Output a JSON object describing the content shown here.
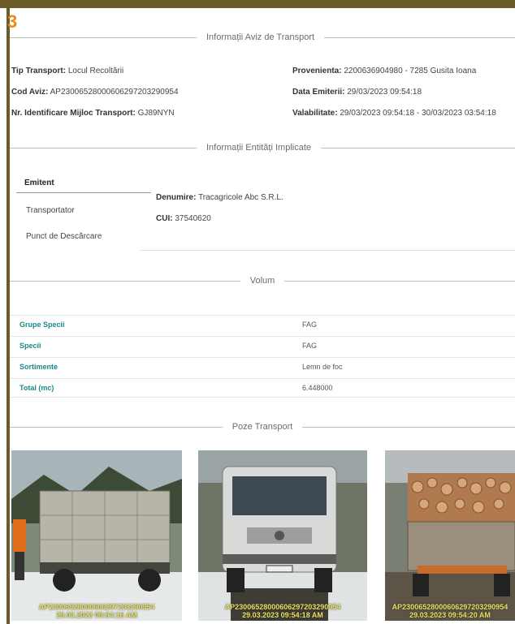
{
  "badge": "3",
  "sections": {
    "aviz": "Informații Aviz de Transport",
    "entitati": "Informații Entități Implicate",
    "volum": "Volum",
    "poze": "Poze Transport"
  },
  "aviz": {
    "tip_label": "Tip Transport:",
    "tip_value": "Locul Recoltării",
    "cod_label": "Cod Aviz:",
    "cod_value": "AP23006528000606297203290954",
    "nr_label": "Nr. Identificare Mijloc Transport:",
    "nr_value": "GJ89NYN",
    "prov_label": "Provenienta:",
    "prov_value": "2200636904980 - 7285 Gusita Ioana",
    "data_label": "Data Emiterii:",
    "data_value": "29/03/2023 09:54:18",
    "valab_label": "Valabilitate:",
    "valab_value": "29/03/2023 09:54:18 - 30/03/2023 03:54:18"
  },
  "entitati": {
    "tabs": [
      "Emitent",
      "Transportator",
      "Punct de Descărcare"
    ],
    "denumire_label": "Denumire:",
    "denumire_value": "Tracagricole Abc S.R.L.",
    "cui_label": "CUI:",
    "cui_value": "37540620"
  },
  "volum": {
    "rows": [
      {
        "label": "Grupe Specii",
        "value": "FAG"
      },
      {
        "label": "Specii",
        "value": "FAG"
      },
      {
        "label": "Sortimente",
        "value": "Lemn de foc"
      },
      {
        "label": "Total (mc)",
        "value": "6.448000"
      }
    ]
  },
  "poze": {
    "captions": [
      "AP23006528000606297203290954\n29.03.2023 09:54:16 AM",
      "AP23006528000606297203290954\n29.03.2023 09:54:18 AM",
      "AP23006528000606297203290954\n29.03.2023 09:54:20 AM"
    ]
  },
  "colors": {
    "frame": "#6b5a2a",
    "badge": "#e98a1a",
    "teal": "#1a8a8a"
  }
}
